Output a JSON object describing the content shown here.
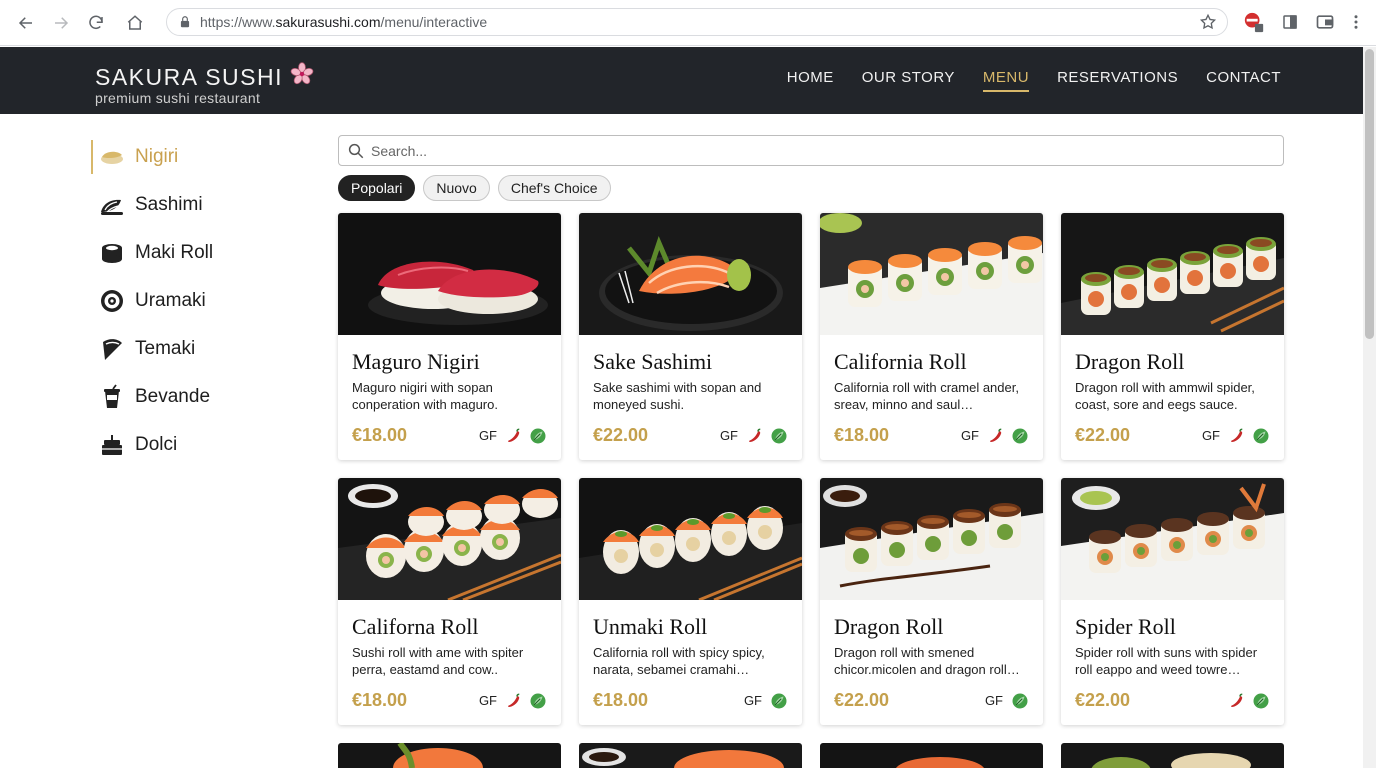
{
  "browser": {
    "url_prefix": "https://www.",
    "url_host": "sakurasushi.com",
    "url_path": "/menu/interactive"
  },
  "header": {
    "brand_title": "SAKURA SUSHI",
    "brand_subtitle": "premium sushi restaurant",
    "nav": [
      {
        "label": "HOME"
      },
      {
        "label": "OUR STORY"
      },
      {
        "label": "MENU"
      },
      {
        "label": "RESERVATIONS"
      },
      {
        "label": "CONTACT"
      }
    ],
    "active_nav": "MENU"
  },
  "sidebar": {
    "active": "Nigiri",
    "items": [
      {
        "label": "Nigiri",
        "icon": "nigiri-icon"
      },
      {
        "label": "Sashimi",
        "icon": "sashimi-icon"
      },
      {
        "label": "Maki Roll",
        "icon": "maki-roll-icon"
      },
      {
        "label": "Uramaki",
        "icon": "uramaki-icon"
      },
      {
        "label": "Temaki",
        "icon": "temaki-icon"
      },
      {
        "label": "Bevande",
        "icon": "drink-icon"
      },
      {
        "label": "Dolci",
        "icon": "cake-icon"
      }
    ]
  },
  "search": {
    "placeholder": "Search..."
  },
  "filters": [
    {
      "label": "Popolari",
      "active": true
    },
    {
      "label": "Nuovo",
      "active": false
    },
    {
      "label": "Chef's Choice",
      "active": false
    }
  ],
  "colors": {
    "accent": "#d8b86a",
    "price": "#c4a04c",
    "header_bg": "#22252a",
    "spicy": "#c62828",
    "vegan": "#43a047"
  },
  "menu_items": [
    {
      "name": "Maguro Nigiri",
      "desc": "Maguro nigiri with sopan conperation with maguro.",
      "price": "€18.00",
      "gf": "GF",
      "spicy": true,
      "vegan": true,
      "image": "nigiri"
    },
    {
      "name": "Sake Sashimi",
      "desc": "Sake sashimi with sopan and moneyed sushi.",
      "price": "€22.00",
      "gf": "GF",
      "spicy": true,
      "vegan": true,
      "image": "sashimi"
    },
    {
      "name": "California Roll",
      "desc": "California roll with cramel ander, sreav, minno and saul…",
      "price": "€18.00",
      "gf": "GF",
      "spicy": true,
      "vegan": true,
      "image": "california-white"
    },
    {
      "name": "Dragon Roll",
      "desc": "Dragon roll with ammwil spider, coast, sore and eegs sauce.",
      "price": "€22.00",
      "gf": "GF",
      "spicy": true,
      "vegan": true,
      "image": "dragon-dark"
    },
    {
      "name": "Californa Roll",
      "desc": "Sushi roll with ame with spiter perra, eastamd and cow..",
      "price": "€18.00",
      "gf": "GF",
      "spicy": true,
      "vegan": true,
      "image": "salmon-roll"
    },
    {
      "name": "Unmaki Roll",
      "desc": "California roll with spicy spicy, narata, sebamei cramahi…",
      "price": "€18.00",
      "gf": "GF",
      "spicy": false,
      "vegan": true,
      "image": "salmon-roll2"
    },
    {
      "name": "Dragon Roll",
      "desc": "Dragon roll with smened chicor.micolen and dragon roll…",
      "price": "€22.00",
      "gf": "GF",
      "spicy": false,
      "vegan": true,
      "image": "eel-white"
    },
    {
      "name": "Spider Roll",
      "desc": "Spider roll with suns with spider roll eappo and weed towre…",
      "price": "€22.00",
      "gf": "",
      "spicy": true,
      "vegan": true,
      "image": "spider-white"
    }
  ]
}
